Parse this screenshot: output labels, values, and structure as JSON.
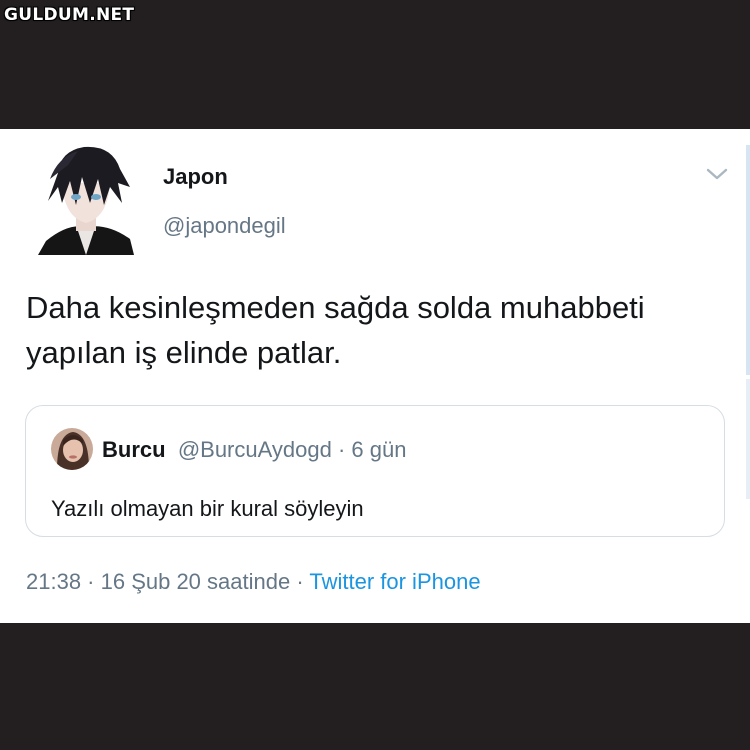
{
  "watermark": "GULDUM.NET",
  "tweet": {
    "author_name": "Japon",
    "author_handle": "@japondegil",
    "text": "Daha kesinleşmeden sağda solda muhabbeti yapılan iş elinde patlar.",
    "quoted": {
      "author_name": "Burcu",
      "author_handle": "@BurcuAydogd",
      "separator": " · ",
      "age": "6 gün",
      "text": "Yazılı olmayan bir kural söyleyin"
    },
    "meta": {
      "time_date": "21:38 · 16 Şub 20 saatinde",
      "separator": " · ",
      "source": "Twitter for iPhone"
    }
  },
  "icons": {
    "menu": "chevron-down-icon"
  },
  "colors": {
    "background": "#231f21",
    "card": "#ffffff",
    "text": "#14171a",
    "secondary": "#657786",
    "link": "#1b95e0"
  }
}
